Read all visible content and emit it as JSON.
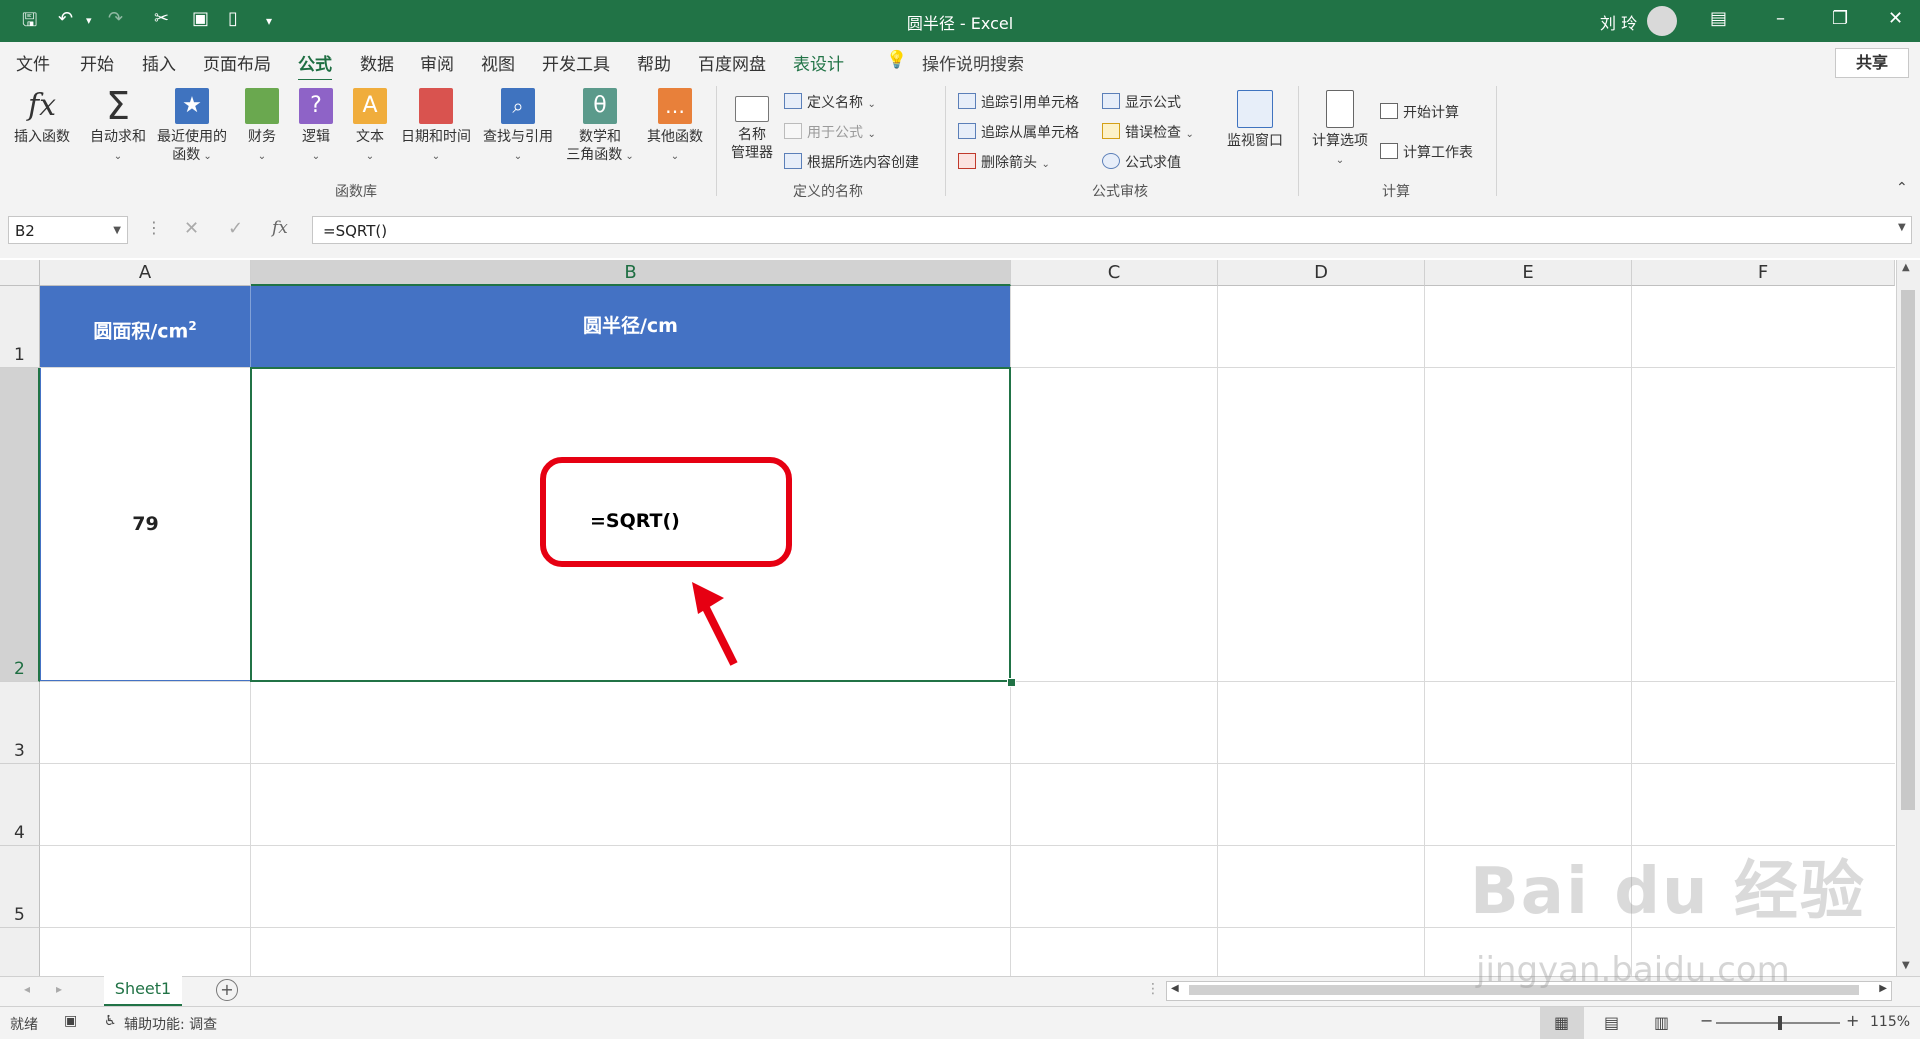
{
  "window": {
    "title": "圆半径  -  Excel",
    "user": "刘 玲"
  },
  "tabs": [
    "文件",
    "开始",
    "插入",
    "页面布局",
    "公式",
    "数据",
    "审阅",
    "视图",
    "开发工具",
    "帮助",
    "百度网盘",
    "表设计"
  ],
  "active_tab": "公式",
  "tell_me": "操作说明搜索",
  "share": "共享",
  "ribbon": {
    "function_library": {
      "insert_function": "插入函数",
      "autosum": "自动求和",
      "recent_1": "最近使用的",
      "recent_2": "函数",
      "financial": "财务",
      "logical": "逻辑",
      "text": "文本",
      "datetime": "日期和时间",
      "lookup": "查找与引用",
      "math_1": "数学和",
      "math_2": "三角函数",
      "more": "其他函数",
      "group": "函数库"
    },
    "defined_names": {
      "name_manager_1": "名称",
      "name_manager_2": "管理器",
      "define_name": "定义名称",
      "use_in_formula": "用于公式",
      "create_from_selection": "根据所选内容创建",
      "group": "定义的名称"
    },
    "formula_auditing": {
      "trace_precedents": "追踪引用单元格",
      "trace_dependents": "追踪从属单元格",
      "remove_arrows": "删除箭头",
      "show_formulas": "显示公式",
      "error_checking": "错误检查",
      "evaluate_formula": "公式求值",
      "watch_window": "监视窗口",
      "group": "公式审核"
    },
    "calculation": {
      "options": "计算选项",
      "calc_now": "开始计算",
      "calc_sheet": "计算工作表",
      "group": "计算"
    }
  },
  "formula_bar": {
    "name_box": "B2",
    "formula": "=SQRT()"
  },
  "columns": [
    "A",
    "B",
    "C",
    "D",
    "E",
    "F"
  ],
  "rows": [
    "1",
    "2",
    "3",
    "4",
    "5"
  ],
  "cells": {
    "A1_base": "圆面积/cm",
    "A1_sup": "2",
    "B1": "圆半径/cm",
    "A2": "79",
    "B2": "=SQRT()"
  },
  "sheet_tab": "Sheet1",
  "status": {
    "ready": "就绪",
    "accessibility": "辅助功能: 调查",
    "zoom": "115%"
  },
  "watermark": {
    "brand": "Bai du 经验",
    "url": "jingyan.baidu.com"
  },
  "colors": {
    "excel_green": "#217346",
    "header_fill": "#4472c4",
    "highlight_red": "#e60012"
  }
}
